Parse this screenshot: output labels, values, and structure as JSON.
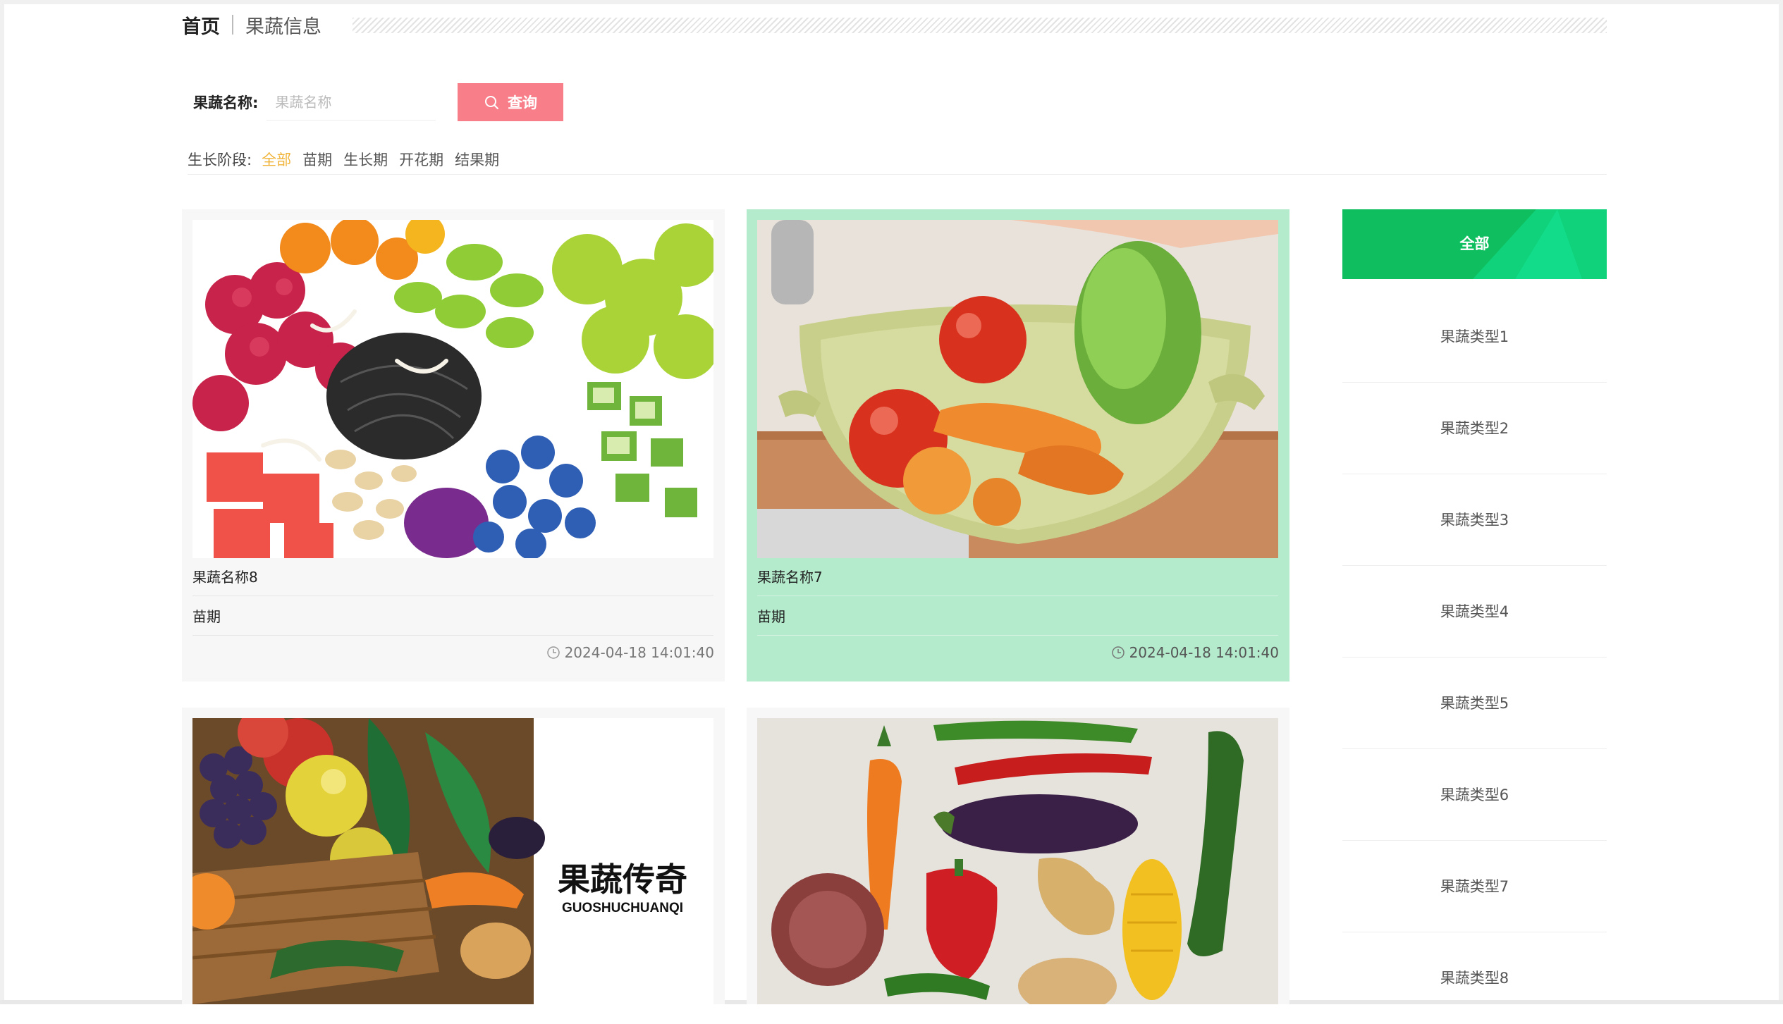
{
  "breadcrumb": {
    "home": "首页",
    "current": "果蔬信息"
  },
  "search": {
    "label": "果蔬名称:",
    "placeholder": "果蔬名称",
    "value": "",
    "button_label": "查询"
  },
  "stage_filter": {
    "label": "生长阶段:",
    "options": [
      "全部",
      "苗期",
      "生长期",
      "开花期",
      "结果期"
    ],
    "active": "全部"
  },
  "cards": [
    {
      "name": "果蔬名称8",
      "stage": "苗期",
      "time": "2024-04-18 14:01:40",
      "image": "mixed-fruit-vegetable-bowl"
    },
    {
      "name": "果蔬名称7",
      "stage": "苗期",
      "time": "2024-04-18 14:01:40",
      "image": "vegetable-colander-photo"
    },
    {
      "name": "",
      "stage": "",
      "time": "",
      "image": "fruit-basket-with-logo",
      "logo_text": "果蔬传奇 GUOSHUCHUANQI"
    },
    {
      "name": "",
      "stage": "",
      "time": "",
      "image": "vegetables-flat-lay"
    }
  ],
  "sidebar": {
    "all_label": "全部",
    "types": [
      "果蔬类型1",
      "果蔬类型2",
      "果蔬类型3",
      "果蔬类型4",
      "果蔬类型5",
      "果蔬类型6",
      "果蔬类型7",
      "果蔬类型8"
    ]
  },
  "colors": {
    "accent_green": "#0fbf5f",
    "highlight_card": "#b3ebcc",
    "query_button": "#f87e8a",
    "active_filter": "#f0b43a"
  },
  "icons": {
    "query": "search-icon",
    "time": "clock-icon"
  }
}
